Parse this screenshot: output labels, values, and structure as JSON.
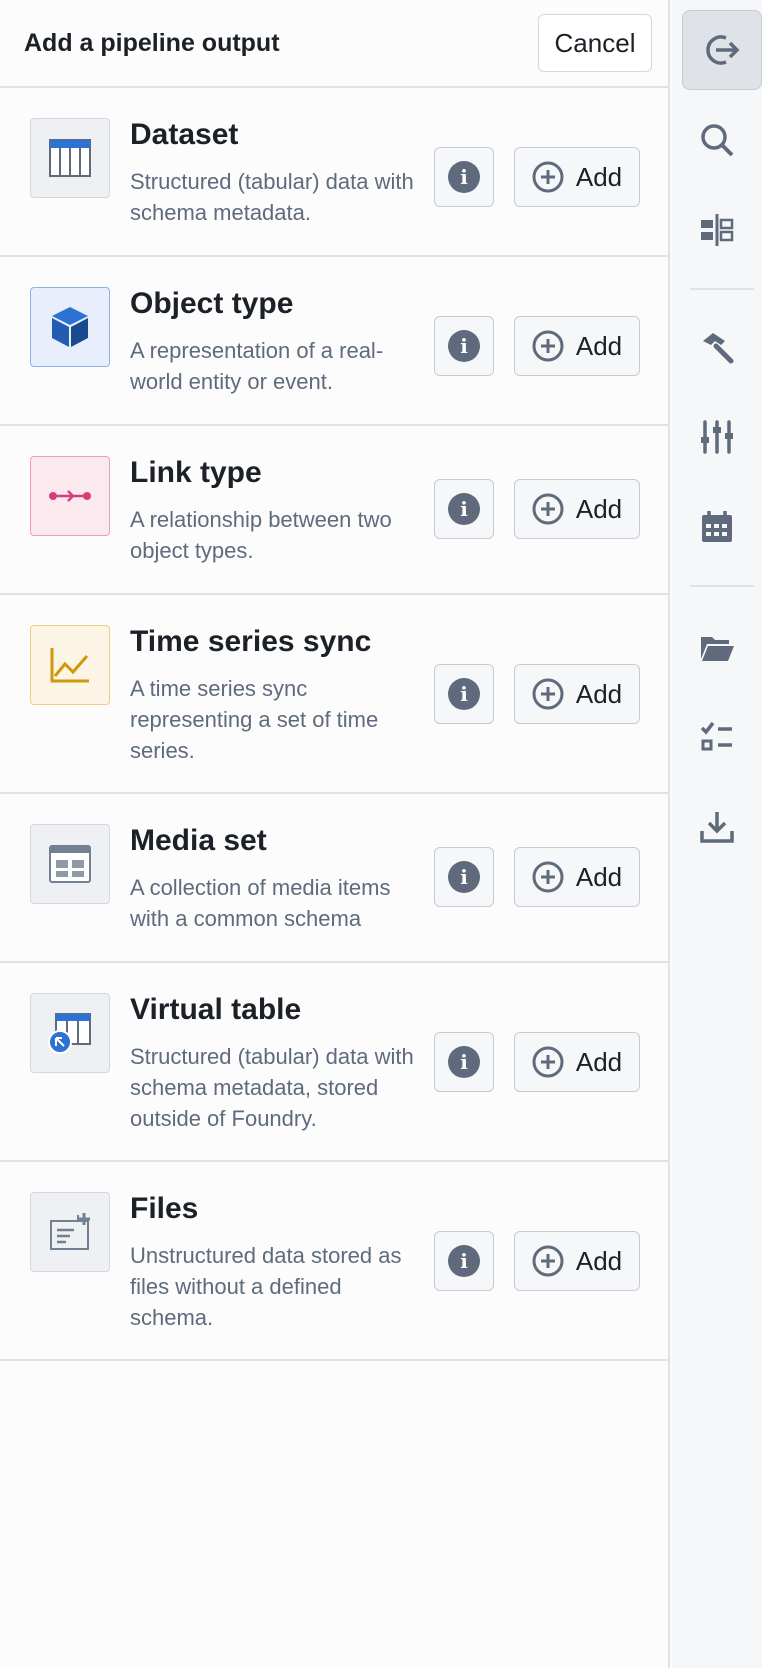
{
  "header": {
    "title": "Add a pipeline output",
    "cancel_label": "Cancel"
  },
  "items": [
    {
      "title": "Dataset",
      "description": "Structured (tabular) data with schema metadata.",
      "icon": "table-icon",
      "add_label": "Add"
    },
    {
      "title": "Object type",
      "description": "A representation of a real-world entity or event.",
      "icon": "cube-icon",
      "add_label": "Add"
    },
    {
      "title": "Link type",
      "description": "A relationship between two object types.",
      "icon": "link-arrow-icon",
      "add_label": "Add"
    },
    {
      "title": "Time series sync",
      "description": "A time series sync representing a set of time series.",
      "icon": "line-chart-icon",
      "add_label": "Add"
    },
    {
      "title": "Media set",
      "description": "A collection of media items with a common schema",
      "icon": "media-icon",
      "add_label": "Add"
    },
    {
      "title": "Virtual table",
      "description": "Structured (tabular) data with schema metadata, stored outside of Foundry.",
      "icon": "virtual-table-icon",
      "add_label": "Add"
    },
    {
      "title": "Files",
      "description": "Unstructured data stored as files without a defined schema.",
      "icon": "files-icon",
      "add_label": "Add"
    }
  ],
  "sidebar": {
    "icons": [
      "exit-icon",
      "search-icon",
      "layout-icon",
      "hammer-icon",
      "sliders-icon",
      "calendar-icon",
      "folder-icon",
      "checklist-icon",
      "download-icon"
    ]
  },
  "colors": {
    "dataset": "#2d72d2",
    "object": "#215db0",
    "link": "#d33d7c",
    "timeseries": "#d1980b",
    "icon_gray": "#5f6b7c"
  }
}
